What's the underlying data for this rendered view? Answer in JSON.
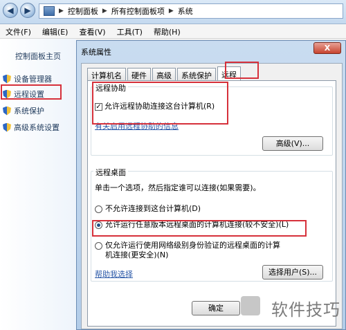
{
  "address_bar": {
    "crumbs": [
      "控制面板",
      "所有控制面板项",
      "系统"
    ]
  },
  "menu": [
    "文件(F)",
    "编辑(E)",
    "查看(V)",
    "工具(T)",
    "帮助(H)"
  ],
  "left_panel": {
    "home": "控制面板主页",
    "items": [
      "设备管理器",
      "远程设置",
      "系统保护",
      "高级系统设置"
    ]
  },
  "dialog": {
    "title": "系统属性",
    "close_label": "X",
    "tabs": [
      "计算机名",
      "硬件",
      "高级",
      "系统保护",
      "远程"
    ],
    "remote_assist": {
      "legend": "远程协助",
      "checkbox_label": "允许远程协助连接这台计算机(R)",
      "checked": true,
      "info_link": "有关启用远程协助的信息",
      "advanced_button": "高级(V)..."
    },
    "remote_desktop": {
      "legend": "远程桌面",
      "instruction": "单击一个选项，然后指定谁可以连接(如果需要)。",
      "option1": "不允许连接到这台计算机(D)",
      "option2": "允许运行任意版本远程桌面的计算机连接(较不安全)(L)",
      "option3_line1": "仅允许运行使用网络级别身份验证的远程桌面的计算",
      "option3_line2": "机连接(更安全)(N)",
      "selected_option": 2,
      "help_link": "帮助我选择",
      "select_users_button": "选择用户(S)..."
    },
    "ok_button": "确定"
  },
  "watermark": "软件技巧"
}
